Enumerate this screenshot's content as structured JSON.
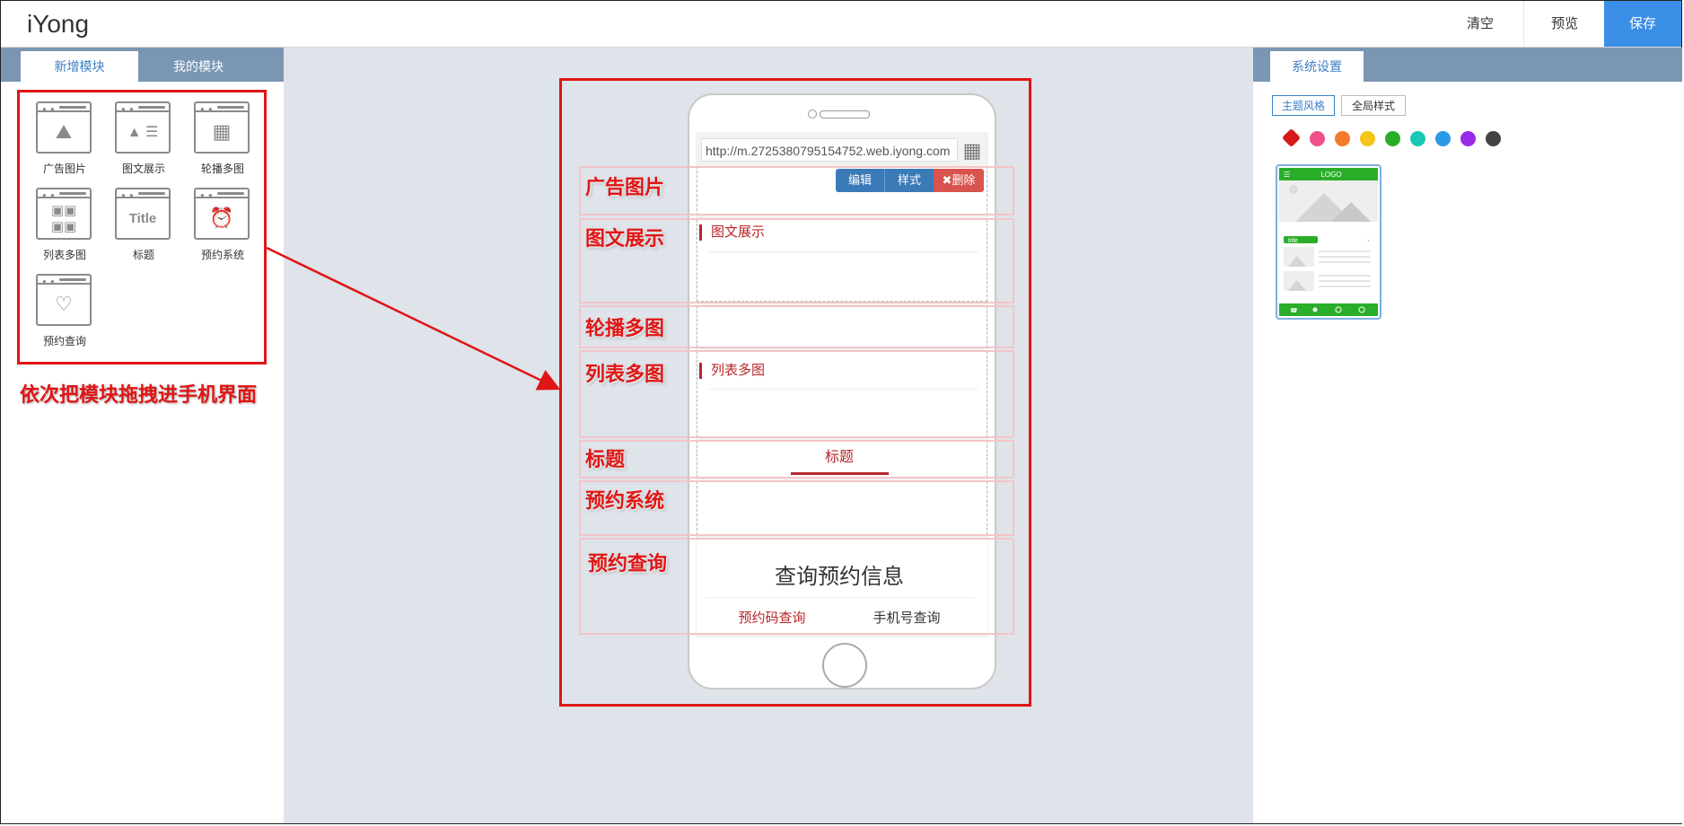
{
  "header": {
    "logo": "iYong",
    "clear_label": "清空",
    "preview_label": "预览",
    "save_label": "保存"
  },
  "left_panel": {
    "tabs": [
      {
        "label": "新增模块",
        "active": true
      },
      {
        "label": "我的模块",
        "active": false
      }
    ],
    "modules": [
      {
        "label": "广告图片",
        "icon": "ad-image-icon"
      },
      {
        "label": "图文展示",
        "icon": "image-text-icon"
      },
      {
        "label": "轮播多图",
        "icon": "carousel-icon"
      },
      {
        "label": "列表多图",
        "icon": "image-list-icon"
      },
      {
        "label": "标题",
        "icon": "title-icon"
      },
      {
        "label": "预约系统",
        "icon": "alarm-clock-icon"
      },
      {
        "label": "预约查询",
        "icon": "heart-icon"
      }
    ],
    "hint": "依次把模块拖拽进手机界面"
  },
  "phone": {
    "url": "http://m.2725380795154752.web.iyong.com",
    "edit_label": "编辑",
    "style_label": "样式",
    "delete_label": "✖删除",
    "image_text_title": "图文展示",
    "list_images_title": "列表多图",
    "title_text": "标题",
    "query_heading": "查询预约信息",
    "query_tab_code": "预约码查询",
    "query_tab_phone": "手机号查询"
  },
  "annotations": [
    "广告图片",
    "图文展示",
    "轮播多图",
    "列表多图",
    "标题",
    "预约系统",
    "预约查询"
  ],
  "right_panel": {
    "tab_label": "系统设置",
    "theme_button": "主题风格",
    "global_button": "全局样式",
    "swatches": [
      "#d61a1a",
      "#f0508a",
      "#f47a2a",
      "#f5c518",
      "#2aae2a",
      "#1ac7b5",
      "#2a9ae6",
      "#9a2ae6",
      "#444444"
    ],
    "selected_swatch": "#d61a1a",
    "thumb_logo": "LOGO",
    "thumb_tag": "title",
    "thumb_accent": "#2aae2a"
  },
  "colors": {
    "accent": "#3a8ee6",
    "annotation": "#e01515",
    "theme_red": "#b8262a",
    "tab_bar": "#7a96b3",
    "canvas": "#dfe3ea"
  }
}
